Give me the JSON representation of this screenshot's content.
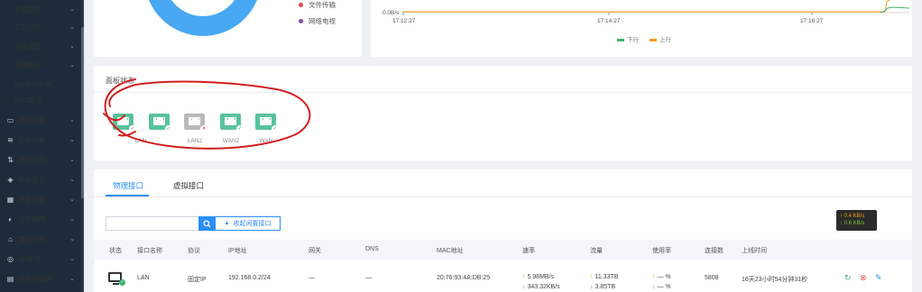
{
  "sidebar": {
    "items": [
      {
        "label": "主机监控",
        "icon": "",
        "sub": true
      },
      {
        "label": "实时监控",
        "icon": "",
        "sub": true
      },
      {
        "label": "历史监控",
        "icon": "",
        "sub": true
      },
      {
        "label": "应用统计",
        "icon": "",
        "sub": true
      },
      {
        "label": "QQ在线列表",
        "icon": "",
        "sub": true,
        "plain": true
      },
      {
        "label": "接口概览",
        "icon": "",
        "sub": true,
        "plain": true
      },
      {
        "label": "网络设置",
        "icon": "monitor-icon"
      },
      {
        "label": "无线设置",
        "icon": "wifi-icon"
      },
      {
        "label": "流控多线",
        "icon": "flow-icon"
      },
      {
        "label": "网络安全",
        "icon": "shield-icon"
      },
      {
        "label": "分组管理",
        "icon": "group-icon"
      },
      {
        "label": "行为管理",
        "icon": "behavior-icon"
      },
      {
        "label": "虚拟专网",
        "icon": "vpn-icon"
      },
      {
        "label": "AP管理",
        "icon": "ap-icon"
      },
      {
        "label": "交换机管理",
        "icon": "switch-icon"
      }
    ]
  },
  "app_legend": {
    "items": [
      {
        "label": "文件传输",
        "color": "#e0484e"
      },
      {
        "label": "网络电视",
        "color": "#8e44ad"
      }
    ]
  },
  "traffic": {
    "y_label": "0.0B/s",
    "x_ticks": [
      "17:12:27",
      "17:14:27",
      "17:16:27"
    ],
    "legend_down": "下行",
    "legend_up": "上行",
    "down_color": "#3cb371",
    "up_color": "#f39c12"
  },
  "panel": {
    "title": "面板状态",
    "ports": [
      {
        "label": "LAN",
        "status": "on"
      },
      {
        "label": "",
        "status": "on"
      },
      {
        "label": "LAN2",
        "status": "off"
      },
      {
        "label": "WAN2",
        "status": "on"
      },
      {
        "label": "WAN",
        "status": "on"
      }
    ]
  },
  "tabs": {
    "physical": "物理接口",
    "virtual": "虚拟接口"
  },
  "search": {
    "placeholder": "",
    "toggle_label": "收起闲置接口"
  },
  "speed_box": {
    "up": "0.4 KB/s",
    "down": "0.6 KB/s"
  },
  "table": {
    "headers": [
      "状态",
      "接口名称",
      "协议",
      "IP地址",
      "网关",
      "DNS",
      "MAC地址",
      "速率",
      "流量",
      "使用率",
      "连接数",
      "上线时间"
    ],
    "rows": [
      {
        "name": "LAN",
        "protocol": "固定IP",
        "ip": "192.168.0.2/24",
        "gateway": "—",
        "dns": "—",
        "mac": "20:76:93:4A:DB:25",
        "rate_up": "5.98MB/s",
        "rate_down": "343.32KB/s",
        "traffic_up": "11.33TB",
        "traffic_down": "3.85TB",
        "usage_up": "— %",
        "usage_down": "— %",
        "connections": "5808",
        "uptime": "16天23小时54分钟31秒"
      }
    ]
  }
}
